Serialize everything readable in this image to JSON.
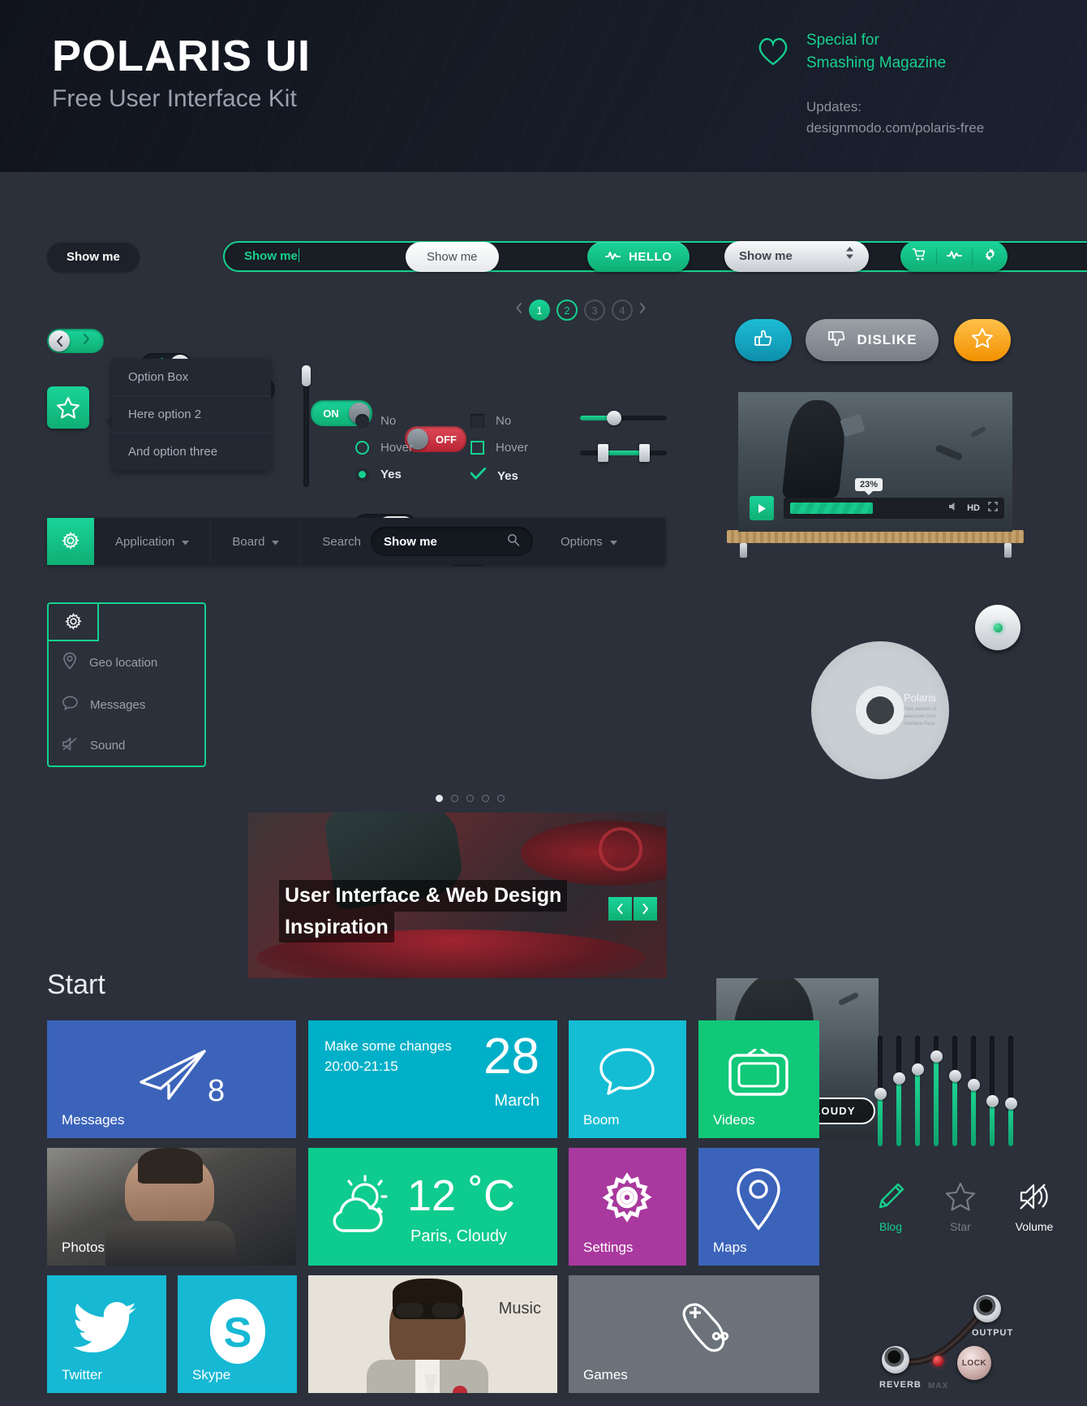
{
  "header": {
    "title": "POLARIS UI",
    "subtitle": "Free User Interface Kit",
    "heart_icon": "heart-icon",
    "special_line1": "Special for",
    "special_line2": "Smashing Magazine",
    "updates_label": "Updates:",
    "updates_url": "designmodo.com/polaris-free"
  },
  "buttons": {
    "dark_label": "Show me",
    "outline_label": "Show me",
    "white_label": "Show me",
    "green_label": "HELLO",
    "green_icon": "pulse-icon",
    "select_label": "Show me",
    "select_icon": "updown-arrows-icon",
    "group": [
      {
        "icon": "cart-icon"
      },
      {
        "icon": "pulse-icon"
      },
      {
        "icon": "gear-icon"
      }
    ]
  },
  "toggles": {
    "arrow_prev": "chevron-left-icon",
    "arrow_next": "chevron-right-icon",
    "check_icon": "check-icon",
    "cross_icon": "cross-icon",
    "on_label": "ON",
    "off_label": "OFF"
  },
  "pagination": {
    "prev": "chevron-left-icon",
    "next": "chevron-right-icon",
    "pages": [
      "1",
      "2",
      "3",
      "4"
    ],
    "active": "1",
    "hover": "2"
  },
  "social": {
    "like_icon": "thumbs-up-icon",
    "dislike_icon": "thumbs-down-icon",
    "dislike_label": "DISLIKE",
    "star_icon": "star-icon",
    "like_color": "#13a9c4",
    "star_color": "#f5a623"
  },
  "optionbox": {
    "star_icon": "star-icon",
    "items": [
      "Option Box",
      "Here option 2",
      "And option three"
    ]
  },
  "choices": {
    "radios": [
      {
        "label": "No",
        "state": "off"
      },
      {
        "label": "Hover",
        "state": "hover"
      },
      {
        "label": "Yes",
        "state": "on"
      }
    ],
    "checkboxes": [
      {
        "label": "No",
        "state": "off"
      },
      {
        "label": "Hover",
        "state": "hover"
      },
      {
        "label": "Yes",
        "state": "on"
      }
    ]
  },
  "navbar": {
    "gear_icon": "gear-icon",
    "items": [
      {
        "label": "Application",
        "caret": true
      },
      {
        "label": "Board",
        "caret": true
      },
      {
        "label": "Search",
        "caret": false
      }
    ],
    "search_value": "Show me",
    "search_icon": "search-icon",
    "options_label": "Options",
    "options_caret": true
  },
  "video": {
    "play_icon": "play-icon",
    "progress_label": "23%",
    "progress_pct": 23,
    "volume_icon": "volume-icon",
    "hd_label": "HD",
    "fullscreen_icon": "fullscreen-icon"
  },
  "sidemenu": {
    "tab_icon": "gear-icon",
    "items": [
      {
        "label": "Geo location",
        "icon": "map-pin-icon"
      },
      {
        "label": "Messages",
        "icon": "speech-bubble-icon"
      },
      {
        "label": "Sound",
        "icon": "sound-muted-icon"
      }
    ]
  },
  "hero": {
    "line1": "User Interface & Web Design",
    "line2": "Inspiration",
    "prev_icon": "chevron-left-icon",
    "next_icon": "chevron-right-icon",
    "dots": 5,
    "active_dot": 0
  },
  "cd": {
    "badge": "PARTY CLOUDY",
    "disc_title": "Polaris",
    "disc_sub": "Free version of awesome User Interface Pack",
    "power_icon": "power-button-icon"
  },
  "start": {
    "heading": "Start"
  },
  "tiles": [
    {
      "name": "messages",
      "label": "Messages",
      "badge": "8",
      "icon": "paper-plane-icon",
      "color": "#3b63ba"
    },
    {
      "name": "calendar",
      "label": "",
      "title": "Make some changes",
      "time": "20:00-21:15",
      "day": "28",
      "month": "March",
      "color": "#00b0c8"
    },
    {
      "name": "boom",
      "label": "Boom",
      "icon": "speech-bubble-icon",
      "color": "#14bdd4"
    },
    {
      "name": "videos",
      "label": "Videos",
      "icon": "tv-icon",
      "color": "#11c878"
    },
    {
      "name": "photos",
      "label": "Photos",
      "color": "#5a5f63"
    },
    {
      "name": "weather",
      "label": "",
      "temp": "12",
      "unit": "˚C",
      "place": "Paris, Cloudy",
      "icon": "sun-cloud-icon",
      "color": "#0ecb8e"
    },
    {
      "name": "settings",
      "label": "Settings",
      "icon": "gear-icon",
      "color": "#a9399e"
    },
    {
      "name": "maps",
      "label": "Maps",
      "icon": "map-pin-icon",
      "color": "#3b63ba"
    },
    {
      "name": "twitter",
      "label": "Twitter",
      "icon": "twitter-icon",
      "color": "#16b8d4"
    },
    {
      "name": "skype",
      "label": "Skype",
      "icon": "skype-icon",
      "color": "#16b8d4"
    },
    {
      "name": "music",
      "label": "Music",
      "color": "#e6e2da"
    },
    {
      "name": "games",
      "label": "Games",
      "icon": "gamepad-icon",
      "color": "#6b727a"
    }
  ],
  "equalizer": {
    "count": 8,
    "levels": [
      48,
      62,
      70,
      82,
      64,
      56,
      40,
      38
    ]
  },
  "icon_row": [
    {
      "label": "Blog",
      "icon": "pencil-icon",
      "color": "#15d18e"
    },
    {
      "label": "Star",
      "icon": "star-icon",
      "color": "#767d87"
    },
    {
      "label": "Volume",
      "icon": "volume-muted-icon",
      "color": "#ffffff"
    }
  ],
  "audio_panel": {
    "reverb_label": "REVERB",
    "max_label": "MAX",
    "lock_label": "LOCK",
    "output_label": "OUTPUT"
  }
}
